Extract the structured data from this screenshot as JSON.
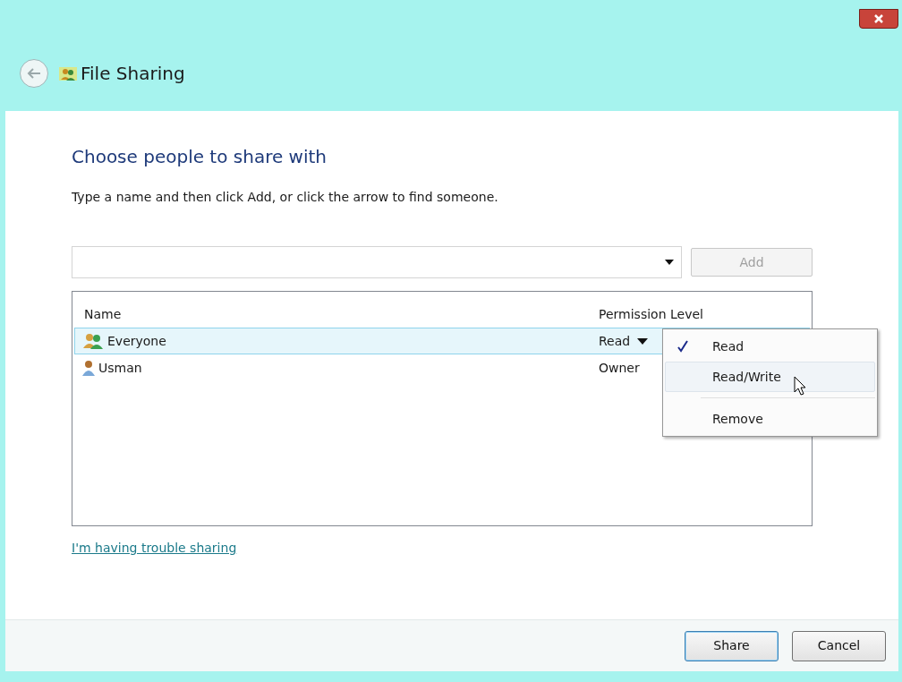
{
  "window": {
    "title": "File Sharing"
  },
  "heading": "Choose people to share with",
  "instruction": "Type a name and then click Add, or click the arrow to find someone.",
  "add_button": {
    "label": "Add",
    "disabled": true
  },
  "table": {
    "columns": [
      "Name",
      "Permission Level"
    ],
    "rows": [
      {
        "kind": "group",
        "name": "Everyone",
        "permission": "Read",
        "dropdown": true,
        "selected": true
      },
      {
        "kind": "user",
        "name": "Usman",
        "permission": "Owner",
        "dropdown": false,
        "selected": false
      }
    ]
  },
  "permission_menu": [
    {
      "label": "Read",
      "checked": true,
      "hovered": false
    },
    {
      "label": "Read/Write",
      "checked": false,
      "hovered": true
    },
    {
      "label": "Remove",
      "checked": false,
      "hovered": false
    }
  ],
  "help_link": "I'm having trouble sharing",
  "buttons": [
    {
      "label": "Share",
      "default": true
    },
    {
      "label": "Cancel",
      "default": false
    }
  ]
}
